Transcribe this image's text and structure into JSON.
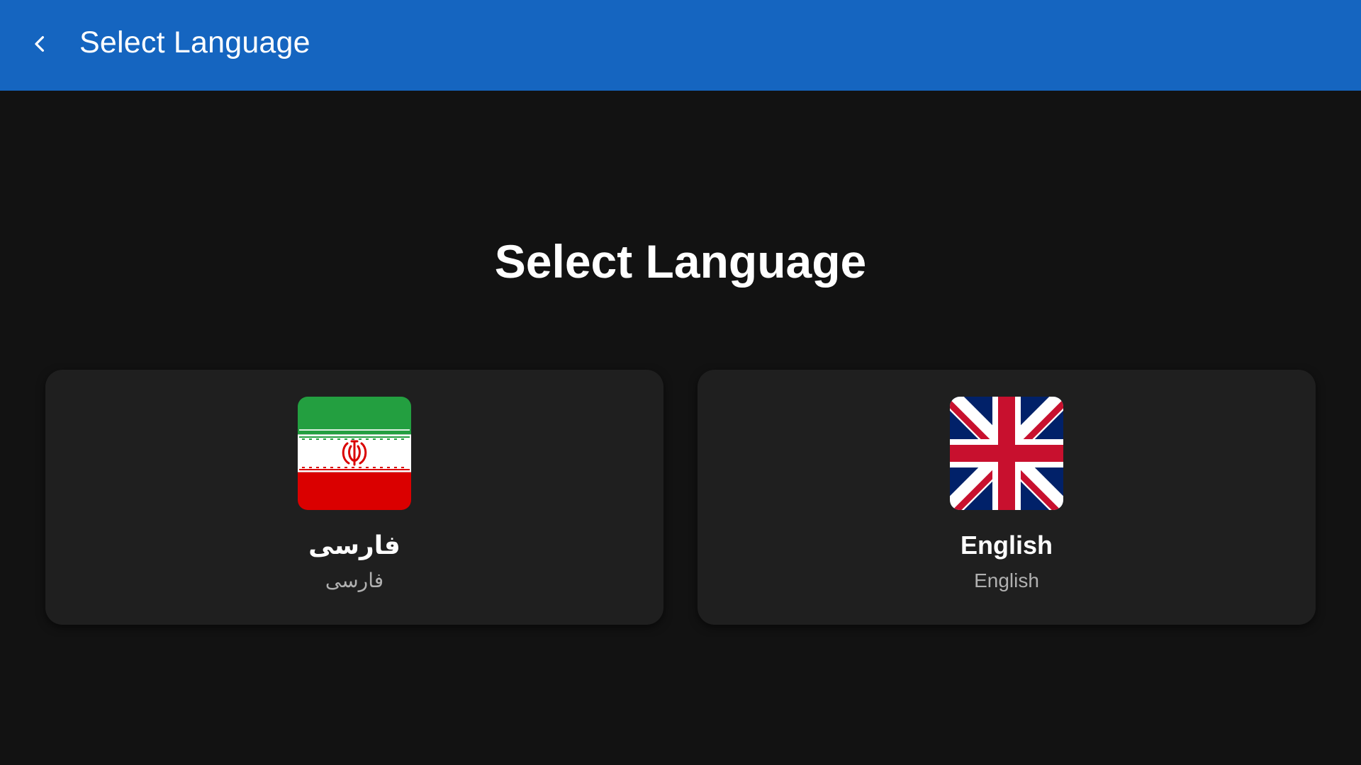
{
  "app_bar": {
    "title": "Select Language",
    "back_icon": "chevron-left-icon",
    "background_color": "#1565c0"
  },
  "heading": "Select Language",
  "languages": [
    {
      "name": "فارسی",
      "native_name": "فارسی",
      "flag_icon": "iran-flag-icon"
    },
    {
      "name": "English",
      "native_name": "English",
      "flag_icon": "uk-flag-icon"
    }
  ],
  "colors": {
    "background": "#121212",
    "card": "#1f1f1f",
    "secondary_text": "#b0b0b0"
  }
}
